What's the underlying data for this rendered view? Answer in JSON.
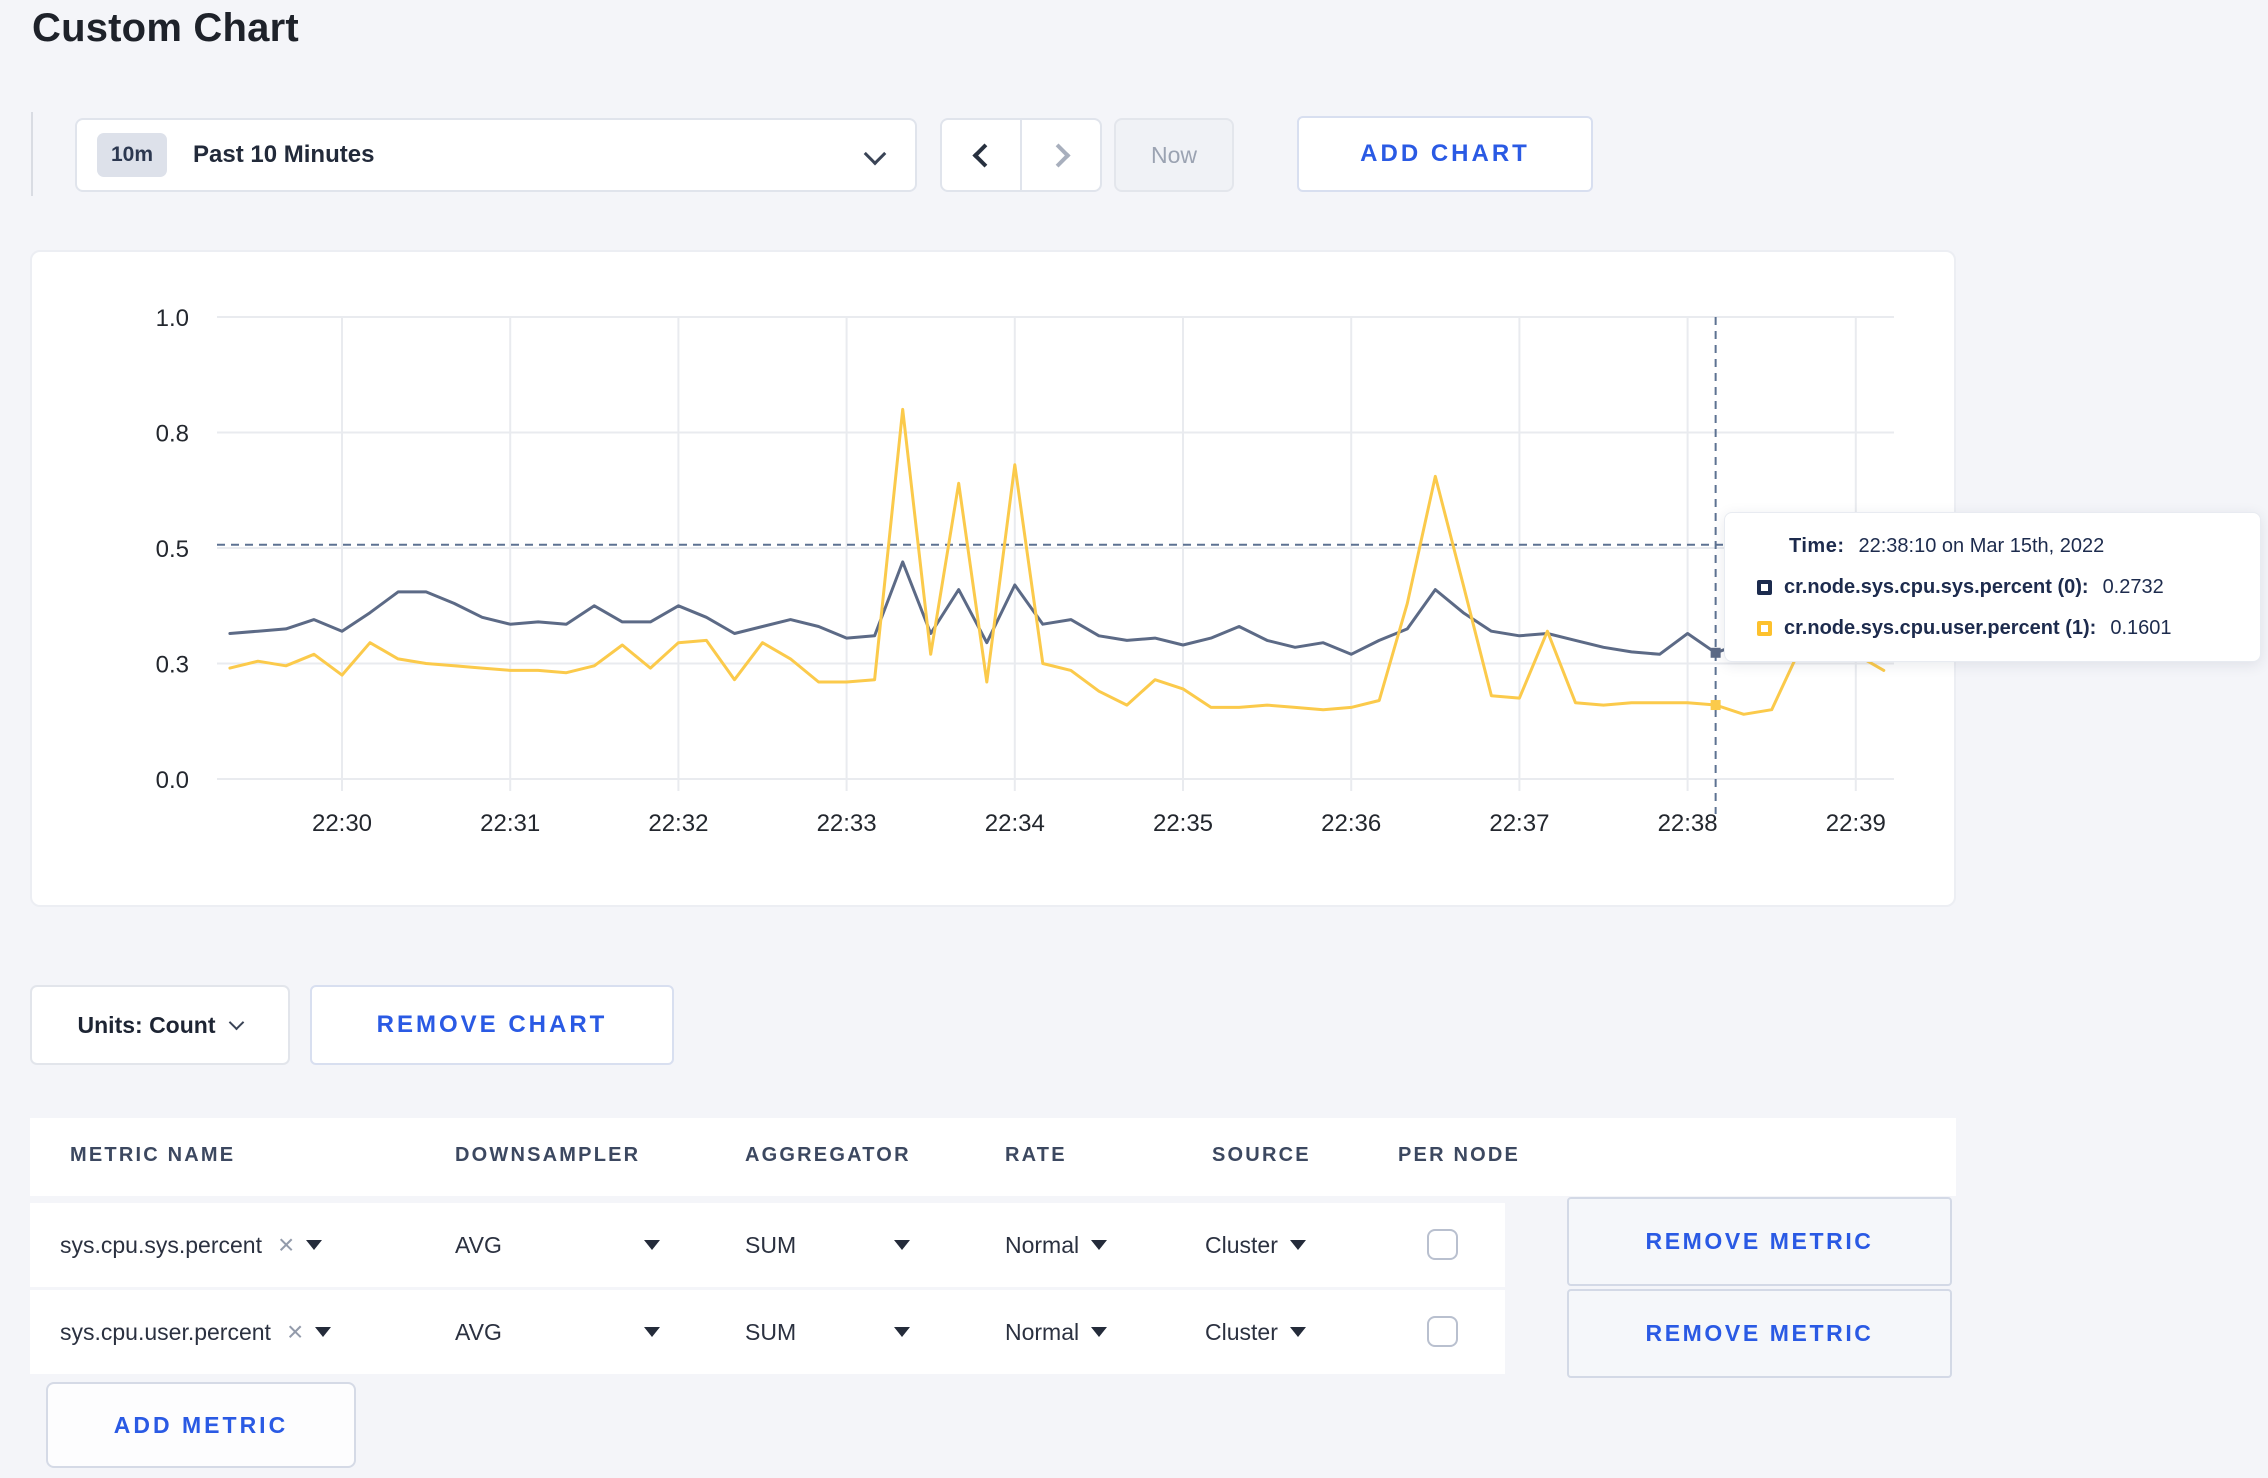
{
  "page": {
    "title": "Custom Chart",
    "background": "#f4f5f9",
    "accent_blue": "#2a5ae4"
  },
  "toolbar": {
    "range_badge": "10m",
    "range_label": "Past 10 Minutes",
    "now_label": "Now",
    "add_chart_label": "ADD CHART"
  },
  "chart_data": {
    "type": "line",
    "title": "",
    "xlabel": "",
    "ylabel": "",
    "ylim": [
      0,
      1
    ],
    "grid": true,
    "x_ticks": [
      "22:30",
      "22:31",
      "22:32",
      "22:33",
      "22:34",
      "22:35",
      "22:36",
      "22:37",
      "22:38",
      "22:39"
    ],
    "y_ticks": [
      {
        "label": "0.0",
        "value": 0
      },
      {
        "label": "0.3",
        "value": 0.25
      },
      {
        "label": "0.5",
        "value": 0.5
      },
      {
        "label": "0.8",
        "value": 0.75
      },
      {
        "label": "1.0",
        "value": 1.0
      }
    ],
    "points_start": "22:29:20",
    "point_interval_seconds": 10,
    "series": [
      {
        "name": "cr.node.sys.cpu.sys.percent (0)",
        "color": "#5c6a86",
        "values": [
          0.315,
          0.32,
          0.325,
          0.345,
          0.32,
          0.36,
          0.405,
          0.405,
          0.38,
          0.35,
          0.335,
          0.34,
          0.335,
          0.375,
          0.34,
          0.34,
          0.375,
          0.35,
          0.315,
          0.33,
          0.345,
          0.33,
          0.305,
          0.31,
          0.47,
          0.315,
          0.41,
          0.295,
          0.42,
          0.335,
          0.345,
          0.31,
          0.3,
          0.305,
          0.29,
          0.305,
          0.33,
          0.3,
          0.285,
          0.295,
          0.27,
          0.3,
          0.325,
          0.41,
          0.36,
          0.32,
          0.31,
          0.315,
          0.3,
          0.285,
          0.275,
          0.27,
          0.315,
          0.2732,
          0.295,
          0.3,
          0.295,
          0.3,
          0.295,
          0.305
        ]
      },
      {
        "name": "cr.node.sys.cpu.user.percent (1)",
        "color": "#fbca4b",
        "values": [
          0.24,
          0.255,
          0.245,
          0.27,
          0.225,
          0.295,
          0.26,
          0.25,
          0.245,
          0.24,
          0.235,
          0.235,
          0.23,
          0.245,
          0.29,
          0.24,
          0.295,
          0.3,
          0.215,
          0.295,
          0.26,
          0.21,
          0.21,
          0.215,
          0.8,
          0.27,
          0.64,
          0.21,
          0.68,
          0.25,
          0.235,
          0.19,
          0.16,
          0.215,
          0.195,
          0.155,
          0.155,
          0.16,
          0.155,
          0.15,
          0.155,
          0.17,
          0.38,
          0.655,
          0.42,
          0.18,
          0.175,
          0.32,
          0.165,
          0.16,
          0.165,
          0.165,
          0.165,
          0.1601,
          0.14,
          0.15,
          0.28,
          0.27,
          0.27,
          0.235
        ]
      }
    ],
    "crosshair": {
      "x_index": 53,
      "y_value": 0.507
    }
  },
  "tooltip": {
    "time_label": "Time:",
    "time_value": "22:38:10 on Mar 15th, 2022",
    "series": [
      {
        "name": "cr.node.sys.cpu.sys.percent (0):",
        "value": "0.2732",
        "swatch": "#1c2b4e"
      },
      {
        "name": "cr.node.sys.cpu.user.percent (1):",
        "value": "0.1601",
        "swatch": "#fdc12d"
      }
    ]
  },
  "chart_actions": {
    "units_label": "Units: Count",
    "remove_chart_label": "REMOVE CHART"
  },
  "metrics_table": {
    "columns": [
      "METRIC NAME",
      "DOWNSAMPLER",
      "AGGREGATOR",
      "RATE",
      "SOURCE",
      "PER NODE"
    ],
    "rows": [
      {
        "metric_name": "sys.cpu.sys.percent",
        "downsampler": "AVG",
        "aggregator": "SUM",
        "rate": "Normal",
        "source": "Cluster",
        "per_node_checked": false
      },
      {
        "metric_name": "sys.cpu.user.percent",
        "downsampler": "AVG",
        "aggregator": "SUM",
        "rate": "Normal",
        "source": "Cluster",
        "per_node_checked": false
      }
    ],
    "remove_metric_label": "REMOVE METRIC",
    "add_metric_label": "ADD METRIC"
  }
}
